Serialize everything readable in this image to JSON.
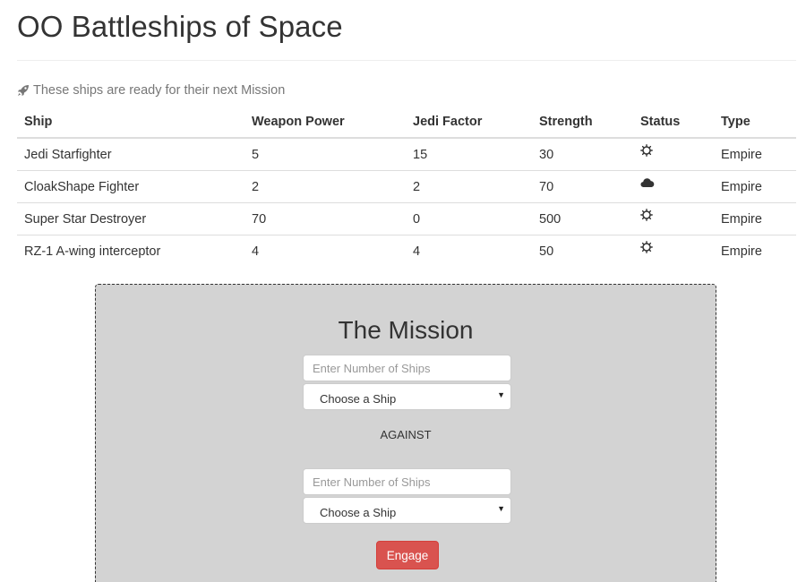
{
  "page": {
    "title": "OO Battleships of Space",
    "caption": "These ships are ready for their next Mission",
    "caption_icon": "rocket-icon"
  },
  "table": {
    "headers": [
      "Ship",
      "Weapon Power",
      "Jedi Factor",
      "Strength",
      "Status",
      "Type"
    ],
    "rows": [
      {
        "ship": "Jedi Starfighter",
        "weapon_power": "5",
        "jedi_factor": "15",
        "strength": "30",
        "status_icon": "sun-icon",
        "type": "Empire"
      },
      {
        "ship": "CloakShape Fighter",
        "weapon_power": "2",
        "jedi_factor": "2",
        "strength": "70",
        "status_icon": "cloud-icon",
        "type": "Empire"
      },
      {
        "ship": "Super Star Destroyer",
        "weapon_power": "70",
        "jedi_factor": "0",
        "strength": "500",
        "status_icon": "sun-icon",
        "type": "Empire"
      },
      {
        "ship": "RZ-1 A-wing interceptor",
        "weapon_power": "4",
        "jedi_factor": "4",
        "strength": "50",
        "status_icon": "sun-icon",
        "type": "Empire"
      }
    ]
  },
  "mission": {
    "title": "The Mission",
    "first_count_placeholder": "Enter Number of Ships",
    "first_ship_selected": "Choose a Ship",
    "against_label": "AGAINST",
    "second_count_placeholder": "Enter Number of Ships",
    "second_ship_selected": "Choose a Ship",
    "engage_label": "Engage"
  },
  "colors": {
    "mission_bg": "#d3d3d3",
    "engage_button": "#d9534f",
    "text": "#333333",
    "muted_text": "#777777"
  }
}
